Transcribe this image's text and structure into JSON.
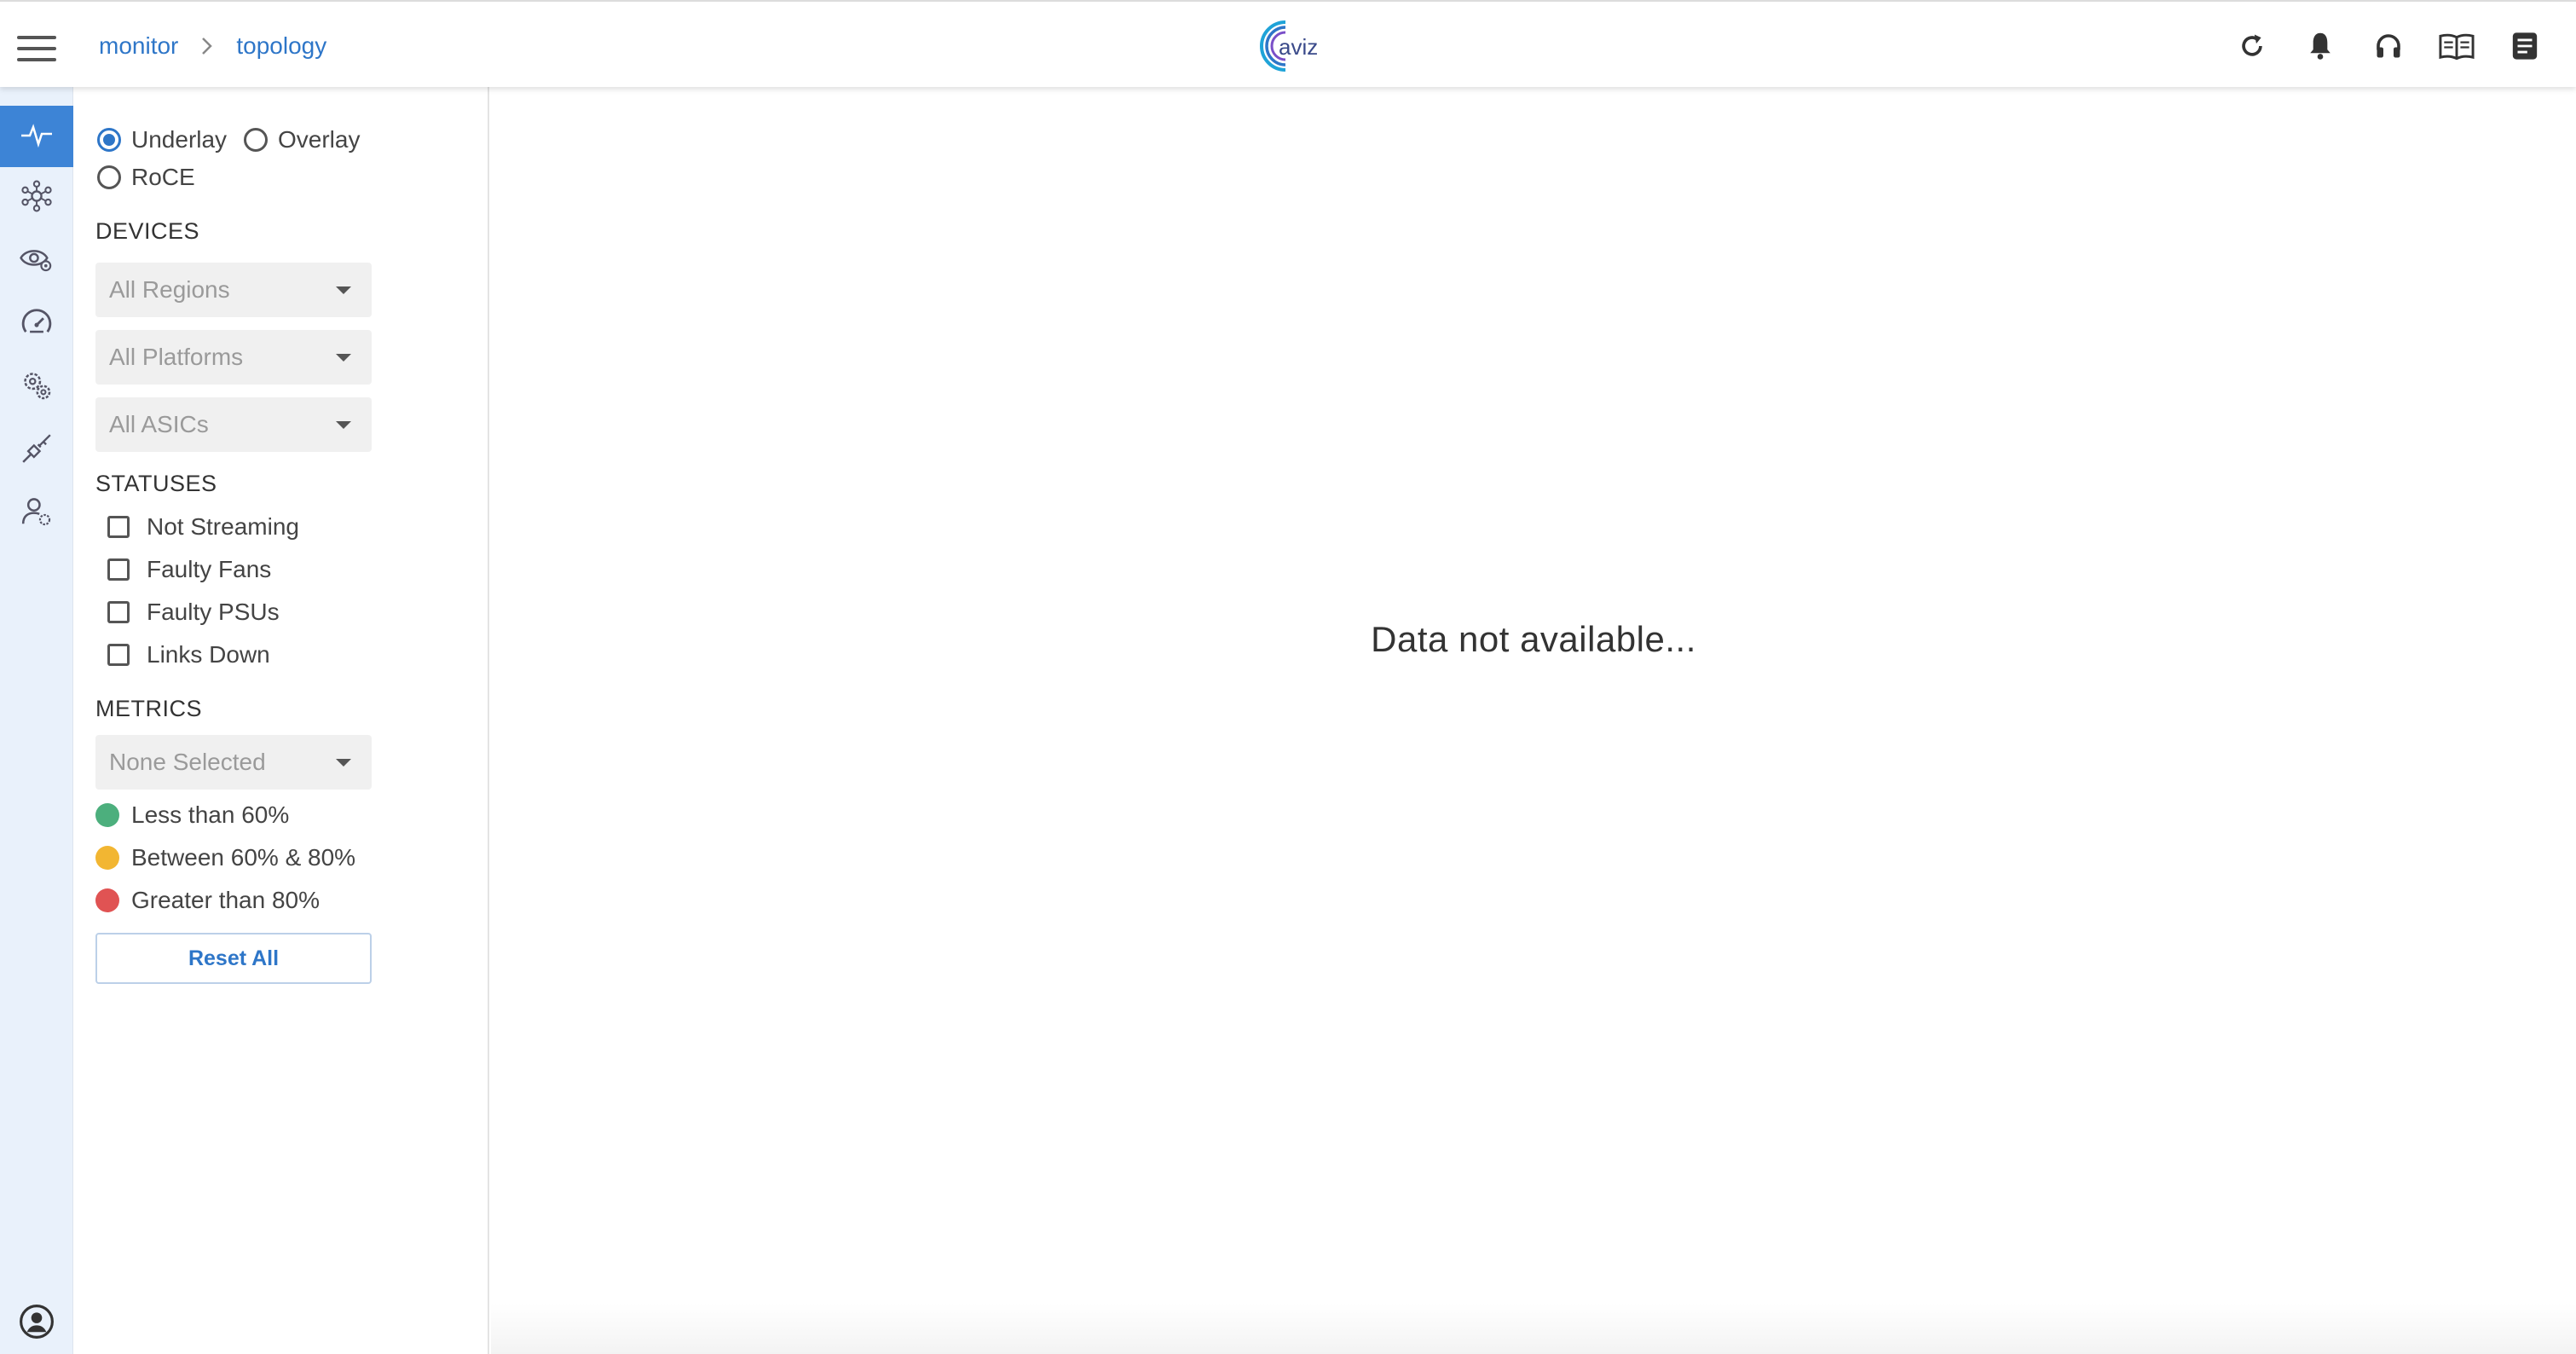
{
  "breadcrumb": {
    "items": [
      "monitor",
      "topology"
    ]
  },
  "logo": {
    "text": "aviz"
  },
  "header_icons": [
    "refresh-icon",
    "bell-icon",
    "headset-icon",
    "book-icon",
    "notes-icon"
  ],
  "rail": {
    "items": [
      "pulse-icon",
      "network-hub-icon",
      "eye-gear-icon",
      "speedometer-icon",
      "gears-icon",
      "plug-icon",
      "user-settings-icon"
    ],
    "active_index": 0,
    "bottom": "account-icon"
  },
  "filters": {
    "layers": [
      {
        "label": "Underlay",
        "checked": true
      },
      {
        "label": "Overlay",
        "checked": false
      },
      {
        "label": "RoCE",
        "checked": false
      }
    ],
    "devices_title": "DEVICES",
    "regions": "All Regions",
    "platforms": "All Platforms",
    "asics": "All ASICs",
    "statuses_title": "STATUSES",
    "statuses": [
      "Not Streaming",
      "Faulty Fans",
      "Faulty PSUs",
      "Links Down"
    ],
    "metrics_title": "METRICS",
    "metric_select": "None Selected",
    "legend": [
      {
        "label": "Less than 60%",
        "color": "#4caf7d"
      },
      {
        "label": "Between 60% & 80%",
        "color": "#f2b632"
      },
      {
        "label": "Greater than 80%",
        "color": "#e05353"
      }
    ],
    "reset_label": "Reset All"
  },
  "main": {
    "empty_message": "Data not available..."
  },
  "colors": {
    "accent": "#2e76c8",
    "rail_bg": "#e9f1fb",
    "rail_active": "#3d84d6"
  }
}
